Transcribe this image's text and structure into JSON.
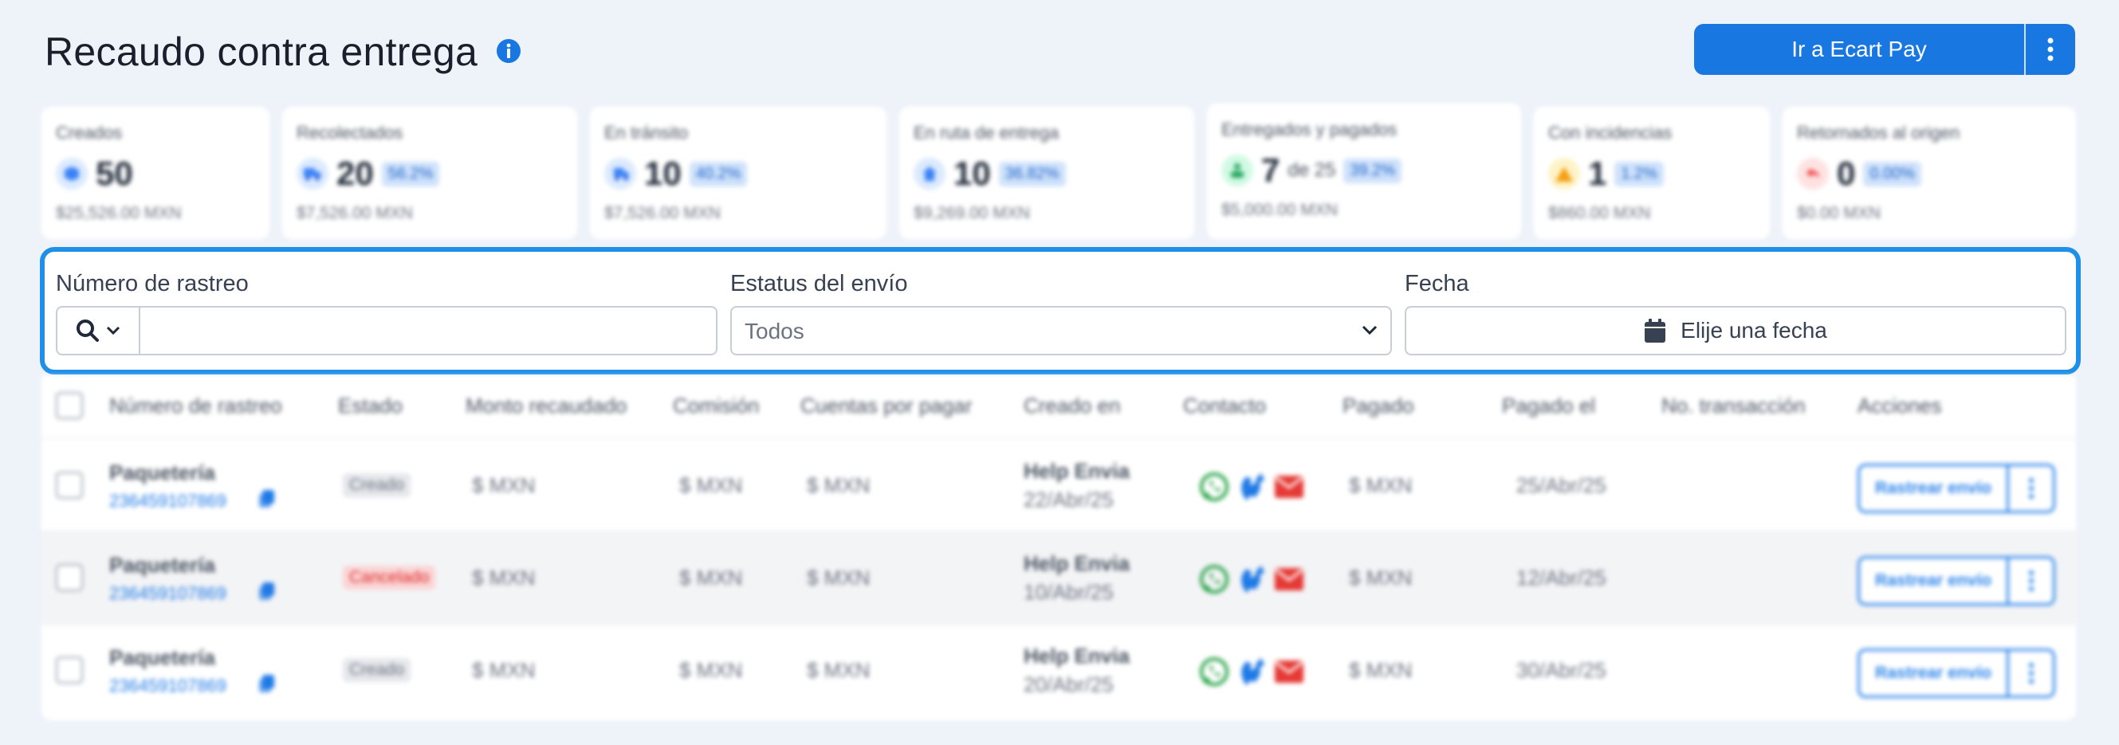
{
  "header": {
    "title": "Recaudo contra entrega",
    "primary_button": "Ir a Ecart Pay"
  },
  "cards": [
    {
      "title": "Creados",
      "value": "50",
      "of": "",
      "pct": "",
      "amount": "$25,526.00 MXN",
      "icon": "box-icon",
      "color": "#3b82f6"
    },
    {
      "title": "Recolectados",
      "value": "20",
      "of": "",
      "pct": "56.2%",
      "amount": "$7,526.00 MXN",
      "icon": "truck-icon",
      "color": "#3b82f6"
    },
    {
      "title": "En tránsito",
      "value": "10",
      "of": "",
      "pct": "40.2%",
      "amount": "$7,526.00 MXN",
      "icon": "truck-fast-icon",
      "color": "#3b82f6"
    },
    {
      "title": "En ruta de entrega",
      "value": "10",
      "of": "",
      "pct": "36.82%",
      "amount": "$9,269.00 MXN",
      "icon": "house-icon",
      "color": "#3b82f6"
    },
    {
      "title": "Entregados y pagados",
      "value": "7",
      "of": "de 25",
      "pct": "39.2%",
      "amount": "$5,000.00 MXN",
      "icon": "people-icon",
      "color": "#22a35a"
    },
    {
      "title": "Con incidencias",
      "value": "1",
      "of": "",
      "pct": "1.2%",
      "amount": "$860.00 MXN",
      "icon": "warning-icon",
      "color": "#f59e0b"
    },
    {
      "title": "Retornados al origen",
      "value": "0",
      "of": "",
      "pct": "0.00%",
      "amount": "$0.00 MXN",
      "icon": "return-icon",
      "color": "#ef4444"
    }
  ],
  "filters": {
    "tracking_label": "Número de rastreo",
    "tracking_value": "",
    "status_label": "Estatus del envío",
    "status_selected": "Todos",
    "date_label": "Fecha",
    "date_placeholder": "Elije una fecha"
  },
  "table": {
    "headers": [
      "Número de rastreo",
      "Estado",
      "Monto recaudado",
      "Comisión",
      "Cuentas por pagar",
      "Creado en",
      "Contacto",
      "Pagado",
      "Pagado el",
      "No. transacción",
      "Acciones"
    ],
    "rows": [
      {
        "carrier": "Paquetería",
        "tracking": "236459107869",
        "status": "Creado",
        "status_kind": "creado",
        "monto": "$   MXN",
        "comision": "$   MXN",
        "cuentas": "$   MXN",
        "created_by": "Help Envia",
        "created_date": "22/Abr/25",
        "pagado": "$   MXN",
        "pagado_el": "25/Abr/25",
        "action": "Rastrear envío"
      },
      {
        "carrier": "Paquetería",
        "tracking": "236459107869",
        "status": "Cancelado",
        "status_kind": "cancelado",
        "monto": "$   MXN",
        "comision": "$   MXN",
        "cuentas": "$   MXN",
        "created_by": "Help Envia",
        "created_date": "10/Abr/25",
        "pagado": "$   MXN",
        "pagado_el": "12/Abr/25",
        "action": "Rastrear envío"
      },
      {
        "carrier": "Paquetería",
        "tracking": "236459107869",
        "status": "Creado",
        "status_kind": "creado",
        "monto": "$   MXN",
        "comision": "$   MXN",
        "cuentas": "$   MXN",
        "created_by": "Help Envia",
        "created_date": "20/Abr/25",
        "pagado": "$   MXN",
        "pagado_el": "30/Abr/25",
        "action": "Rastrear envío"
      }
    ]
  },
  "colors": {
    "accent": "#1877e0",
    "focus_border": "#1f8fe8",
    "whatsapp": "#25a244",
    "phone": "#1f7ae6",
    "mail": "#e53935"
  }
}
